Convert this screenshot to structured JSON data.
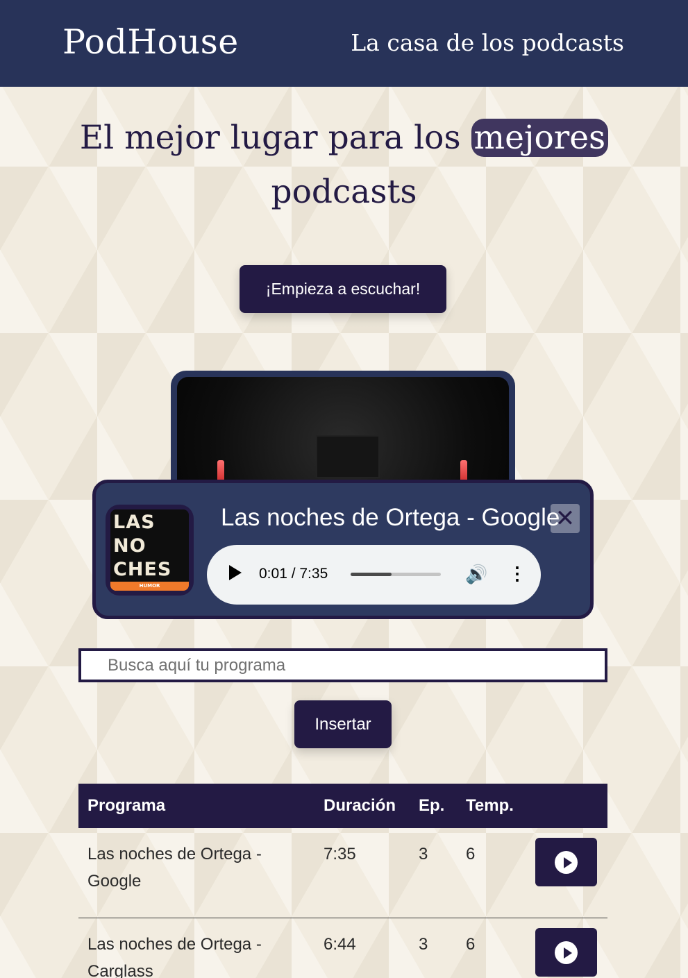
{
  "header": {
    "logo": "PodHouse",
    "tagline": "La casa de los podcasts"
  },
  "hero": {
    "title_before": "El mejor lugar para los ",
    "title_highlight": "mejores",
    "title_after": "podcasts",
    "cta_label": "¡Empieza a escuchar!"
  },
  "player": {
    "cover_text": "LAS NO CHES DE ORTEGA",
    "cover_band": "HUMOR",
    "title": "Las noches de Ortega - Google",
    "close_icon": "close-icon",
    "audio": {
      "time": "0:01 / 7:35",
      "progress": 0.45,
      "play_icon": "play-icon",
      "volume_icon": "volume-icon",
      "more_icon": "more-vertical-icon"
    }
  },
  "search": {
    "placeholder": "Busca aquí tu programa",
    "button_label": "Insertar"
  },
  "table": {
    "headers": [
      "Programa",
      "Duración",
      "Ep.",
      "Temp."
    ],
    "rows": [
      {
        "program": "Las noches de Ortega - Google",
        "duration": "7:35",
        "episode": "3",
        "season": "6"
      },
      {
        "program": "Las noches de Ortega - Carglass",
        "duration": "6:44",
        "episode": "3",
        "season": "6"
      }
    ]
  },
  "colors": {
    "header_bg": "#283359",
    "primary": "#231a44",
    "highlight": "#40365f",
    "player_bg": "#2e3a60",
    "background": "#f2ece0"
  }
}
